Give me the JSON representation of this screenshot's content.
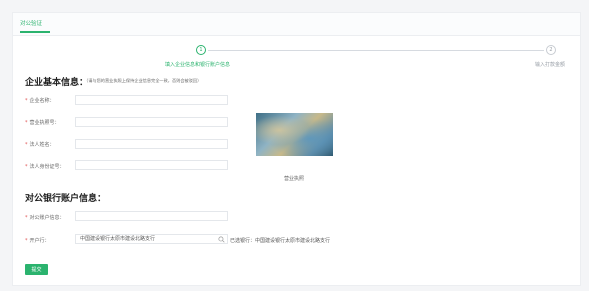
{
  "tabs": [
    {
      "label": "对公验证"
    }
  ],
  "steps": [
    {
      "number": "1",
      "label": "填入企业信息和银行账户信息"
    },
    {
      "number": "2",
      "label": "输入打款金额"
    }
  ],
  "company_section": {
    "title": "企业基本信息：",
    "hint": "（请与您的营业执照上保持企业信息完全一致，否则会被驳回）",
    "fields": [
      {
        "label": "企业名称：",
        "value": ""
      },
      {
        "label": "营业执照号：",
        "value": ""
      },
      {
        "label": "法人姓名：",
        "value": ""
      },
      {
        "label": "法人身份证号：",
        "value": ""
      }
    ],
    "license_caption": "营业执照"
  },
  "bank_section": {
    "title": "对公银行账户信息：",
    "account": {
      "label": "对公账户信息：",
      "value": ""
    },
    "branch": {
      "label": "开户行：",
      "value": "中国建设银行太原市建设北路支行"
    },
    "selected_note": "已选银行：中国建设银行太原市建设北路支行"
  },
  "submit_label": "提交",
  "colors": {
    "accent": "#2bb36e",
    "required": "#e05050"
  }
}
